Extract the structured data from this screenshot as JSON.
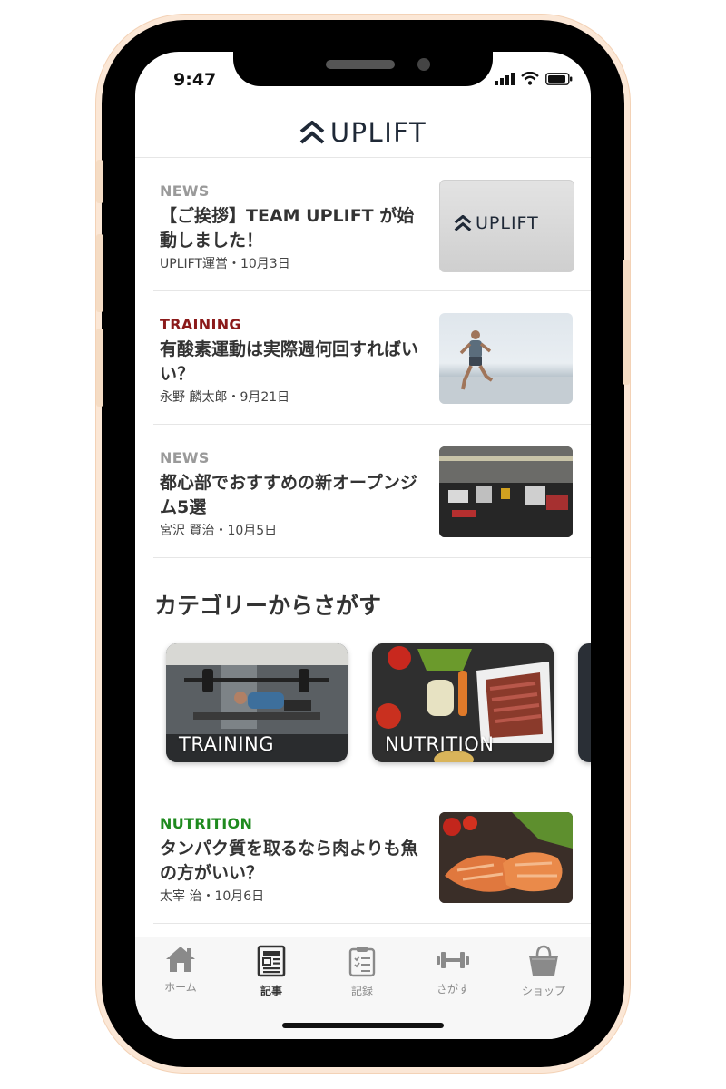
{
  "status_bar": {
    "time": "9:47"
  },
  "header": {
    "logo_text": "UPLIFT"
  },
  "articles": [
    {
      "category": "NEWS",
      "category_color": "#9a9a9a",
      "title": "【ご挨拶】TEAM UPLIFT が始動しました！",
      "meta": "UPLIFT運営・10月3日",
      "thumb_text": "UPLIFT"
    },
    {
      "category": "TRAINING",
      "category_color": "#8b1a1a",
      "title": "有酸素運動は実際週何回すればいい？",
      "meta": "永野 麟太郎・9月21日"
    },
    {
      "category": "NEWS",
      "category_color": "#9a9a9a",
      "title": "都心部でおすすめの新オープンジム5選",
      "meta": "宮沢 賢治・10月5日"
    },
    {
      "category": "NUTRITION",
      "category_color": "#1e8a1e",
      "title": "タンパク質を取るなら肉よりも魚の方がいい？",
      "meta": "太宰 治・10月6日"
    }
  ],
  "categories_section": {
    "title": "カテゴリーからさがす",
    "cards": [
      {
        "label": "TRAINING"
      },
      {
        "label": "NUTRITION"
      }
    ]
  },
  "tabbar": {
    "items": [
      {
        "label": "ホーム",
        "icon": "home-icon"
      },
      {
        "label": "記事",
        "icon": "article-icon"
      },
      {
        "label": "記録",
        "icon": "clipboard-icon"
      },
      {
        "label": "さがす",
        "icon": "dumbbell-icon"
      },
      {
        "label": "ショップ",
        "icon": "shopping-bag-icon"
      }
    ]
  }
}
